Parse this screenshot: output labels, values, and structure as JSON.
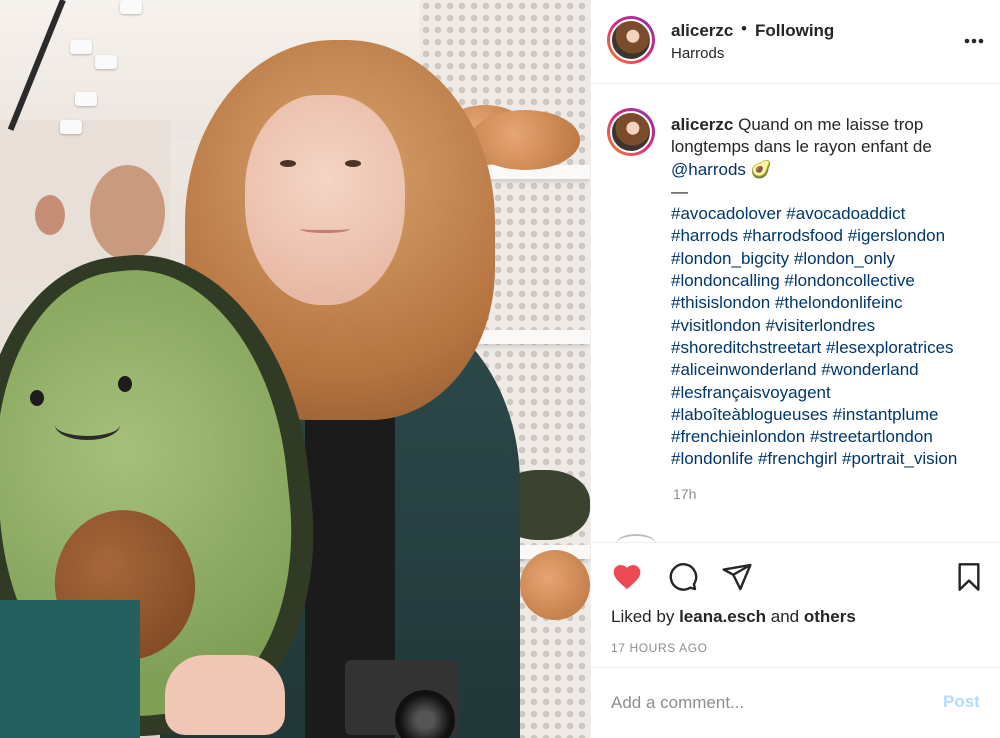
{
  "post": {
    "username": "alicerzc",
    "separator": "•",
    "follow_status": "Following",
    "location": "Harrods"
  },
  "caption": {
    "username": "alicerzc",
    "text_part1": "Quand on me laisse trop longtemps dans le rayon enfant de ",
    "mention": "@harrods",
    "emoji": "🥑",
    "divider": "—",
    "hashtag_lines": [
      "#avocadolover #avocadoaddict",
      "#harrods #harrodsfood #igerslondon",
      "#london_bigcity #london_only",
      "#londoncalling #londoncollective",
      "#thisislondon #thelondonlifeinc",
      "#visitlondon #visiterlondres",
      "#shoreditchstreetart #lesexploratrices",
      "#aliceinwonderland #wonderland",
      "#lesfrançaisvoyagent",
      "#laboîteàblogueuses #instantplume",
      "#frenchieinlondon #streetartlondon",
      "#londonlife #frenchgirl #portrait_vision"
    ],
    "timestamp": "17h"
  },
  "actions": {
    "like_icon": "heart-filled-icon",
    "comment_icon": "comment-icon",
    "share_icon": "share-icon",
    "save_icon": "bookmark-icon",
    "heart_color": "#ed4956",
    "liked_by_prefix": "Liked by",
    "liked_by_user": "leana.esch",
    "liked_by_and": "and",
    "liked_by_others": "others",
    "time_ago": "17 HOURS AGO"
  },
  "comment": {
    "placeholder": "Add a comment...",
    "post_label": "Post"
  },
  "colors": {
    "link": "#00376b",
    "muted": "#8e8e8e",
    "post_disabled": "#b3dbff"
  }
}
